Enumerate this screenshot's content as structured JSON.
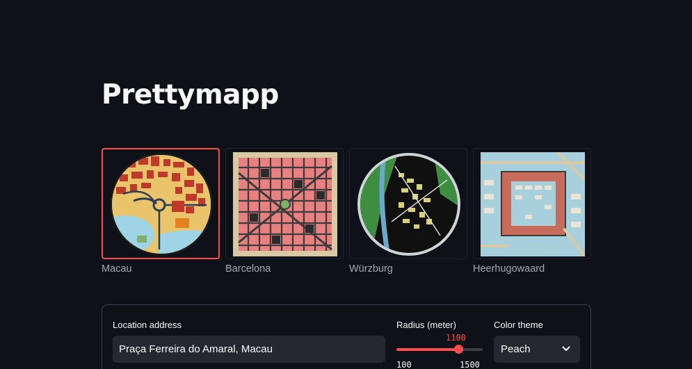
{
  "app": {
    "title": "Prettymapp"
  },
  "gallery": {
    "items": [
      {
        "label": "Macau",
        "selected": true,
        "icon": "map-thumbnail-macau"
      },
      {
        "label": "Barcelona",
        "selected": false,
        "icon": "map-thumbnail-barcelona"
      },
      {
        "label": "Würzburg",
        "selected": false,
        "icon": "map-thumbnail-wurzburg"
      },
      {
        "label": "Heerhugowaard",
        "selected": false,
        "icon": "map-thumbnail-heerhugowaard"
      }
    ],
    "selected_color": "#ff4b4b"
  },
  "form": {
    "address": {
      "label": "Location address",
      "value": "Praça Ferreira do Amaral, Macau"
    },
    "radius": {
      "label": "Radius (meter)",
      "value": "1100",
      "min": "100",
      "max": "1500",
      "fraction": 0.714
    },
    "theme": {
      "label": "Color theme",
      "value": "Peach",
      "icon": "chevron-down-icon"
    }
  },
  "colors": {
    "background": "#0e1117",
    "accent": "#ff4b4b",
    "input_bg": "#262730"
  }
}
